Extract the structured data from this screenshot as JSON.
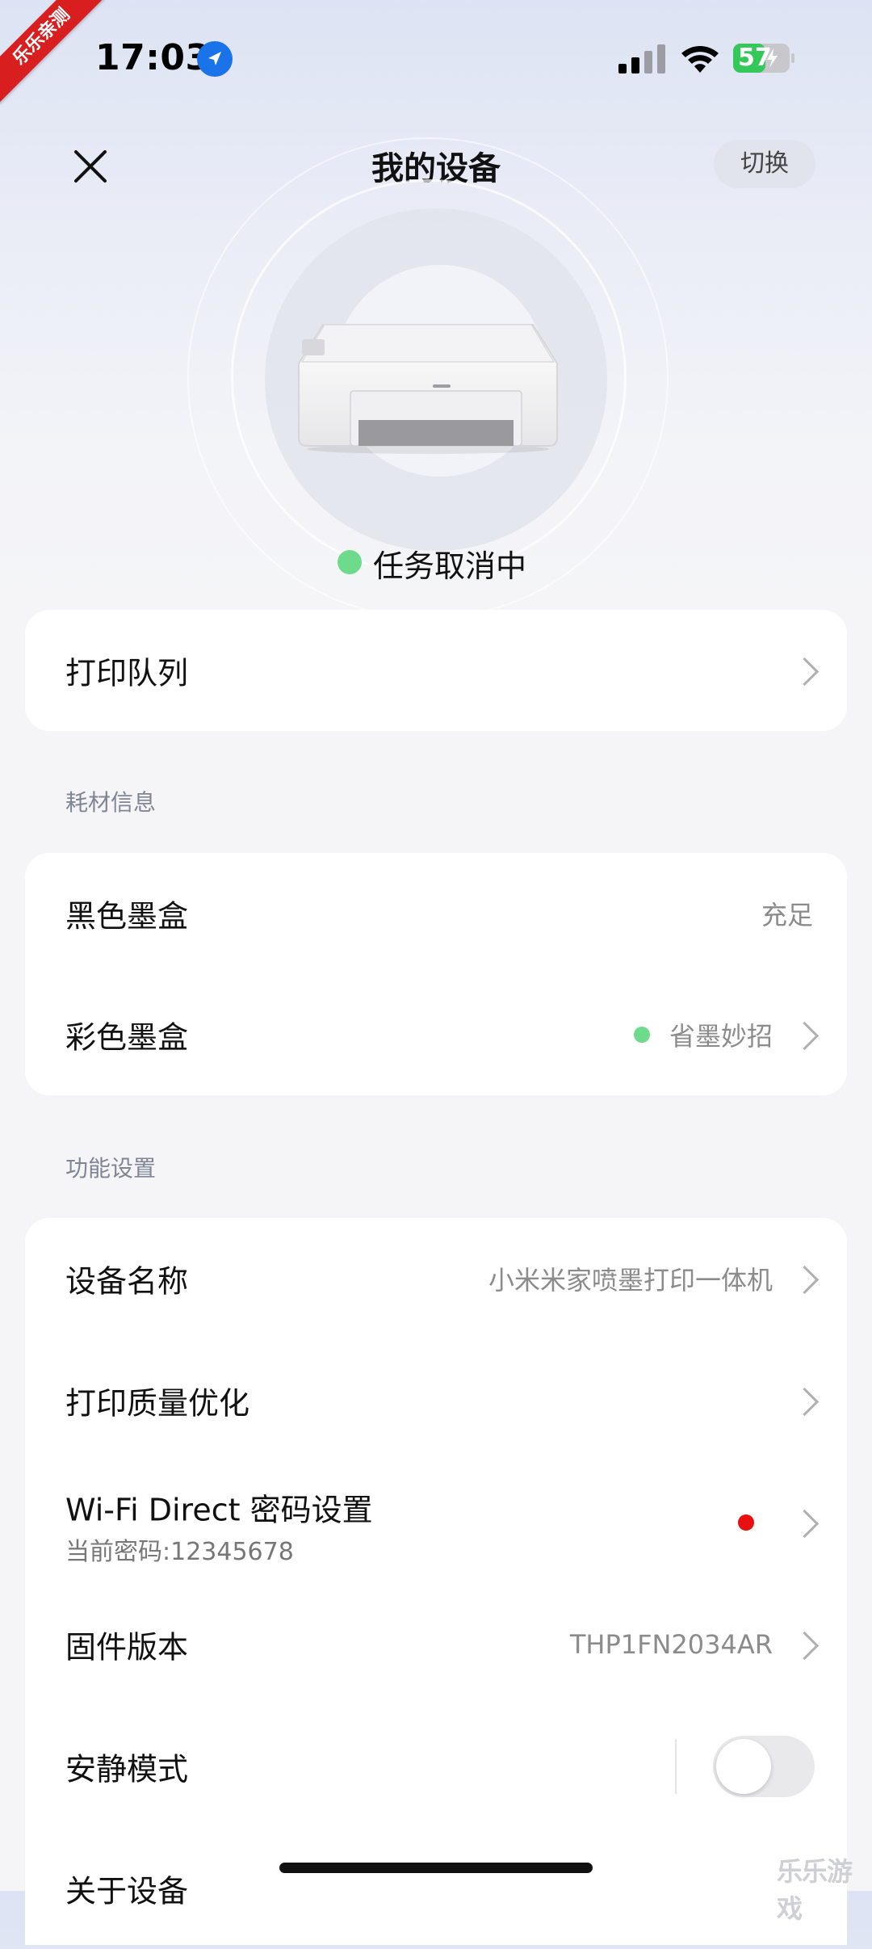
{
  "status_bar": {
    "time": "17:03",
    "battery_level": "57"
  },
  "corner_badge": "乐乐亲测",
  "header": {
    "title": "我的设备",
    "switch_label": "切换"
  },
  "device": {
    "status_text": "任务取消中",
    "status_color": "#6edb8c"
  },
  "print_queue": {
    "label": "打印队列"
  },
  "consumables": {
    "section_title": "耗材信息",
    "rows": [
      {
        "label": "黑色墨盒",
        "value": "充足"
      },
      {
        "label": "彩色墨盒",
        "value": "省墨妙招"
      }
    ]
  },
  "settings": {
    "section_title": "功能设置",
    "rows": [
      {
        "label": "设备名称",
        "value": "小米米家喷墨打印一体机"
      },
      {
        "label": "打印质量优化",
        "value": ""
      },
      {
        "label": "Wi-Fi Direct 密码设置",
        "sub": "当前密码:12345678"
      },
      {
        "label": "固件版本",
        "value": "THP1FN2034AR"
      },
      {
        "label": "安静模式",
        "toggle_on": false
      },
      {
        "label": "关于设备"
      }
    ]
  },
  "watermark": "乐乐游戏",
  "colors": {
    "accent_green": "#6edb8c",
    "alert_red": "#e81010",
    "location_blue": "#1a73e8",
    "battery_green": "#34c759"
  }
}
